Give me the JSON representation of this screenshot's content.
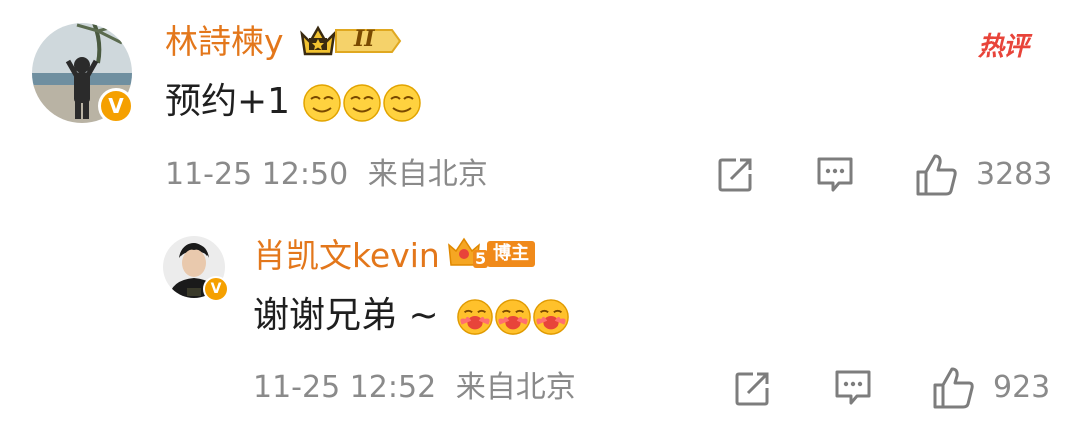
{
  "comments": [
    {
      "username": "林詩楝y",
      "level_badge": "II",
      "hot_tag": "热评",
      "content_text": "预约+1",
      "emojis": [
        "smirk-emoji",
        "smirk-emoji",
        "smirk-emoji"
      ],
      "timestamp": "11-25 12:50",
      "location": "来自北京",
      "likes": "3283"
    },
    {
      "username": "肖凯文kevin",
      "blogger_level": "5",
      "blogger_label": "博主",
      "content_text": "谢谢兄弟 ~",
      "emojis": [
        "kiss-heart-emoji",
        "kiss-heart-emoji",
        "kiss-heart-emoji"
      ],
      "timestamp": "11-25 12:52",
      "location": "来自北京",
      "likes": "923"
    }
  ],
  "icons": {
    "share": "share-icon",
    "comment": "comment-icon",
    "like": "thumbs-up-icon",
    "verified": "verified-v-icon"
  },
  "colors": {
    "username": "#e3771b",
    "meta": "#8a8a8a",
    "verified": "#f5a000",
    "hot": "#e8443a"
  }
}
